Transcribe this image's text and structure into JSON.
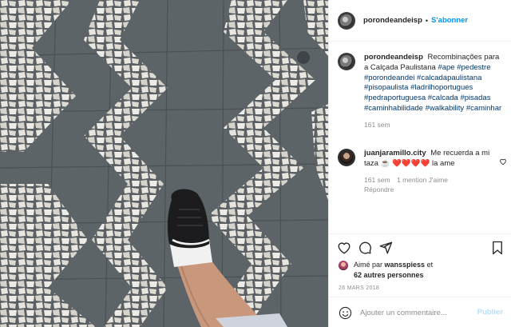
{
  "header": {
    "username": "porondeandeisp",
    "separator": "•",
    "follow_label": "S'abonner"
  },
  "caption": {
    "username": "porondeandeisp",
    "text": "Recombinações para a Calçada Paulistana",
    "hashtags": [
      "#ape",
      "#pedestre",
      "#porondeandei",
      "#calcadapaulistana",
      "#pisopaulista",
      "#ladrilhoportugues",
      "#pedraportuguesa",
      "#calcada",
      "#pisadas",
      "#caminhabilidade",
      "#walkability",
      "#caminhar"
    ],
    "time": "161 sem"
  },
  "comment": {
    "username": "juanjaramillo.city",
    "text": "Me recuerda a mi taza ☕ ❤️❤️❤️❤️ la ame",
    "time": "161 sem",
    "likes": "1 mention J'aime",
    "reply": "Répondre"
  },
  "actions": {
    "like_icon": "heart-icon",
    "comment_icon": "comment-icon",
    "share_icon": "share-icon",
    "save_icon": "bookmark-icon"
  },
  "likes": {
    "prefix": "Aimé par",
    "user": "wansspiess",
    "joiner": "et",
    "others": "62 autres personnes"
  },
  "date": "26 MARS 2018",
  "add_comment": {
    "placeholder": "Ajouter un commentaire...",
    "publish_label": "Publier"
  },
  "colors": {
    "link": "#0095f6",
    "hashtag": "#00376b",
    "muted": "#8e8e8e",
    "publish_disabled": "#b2dffc"
  }
}
